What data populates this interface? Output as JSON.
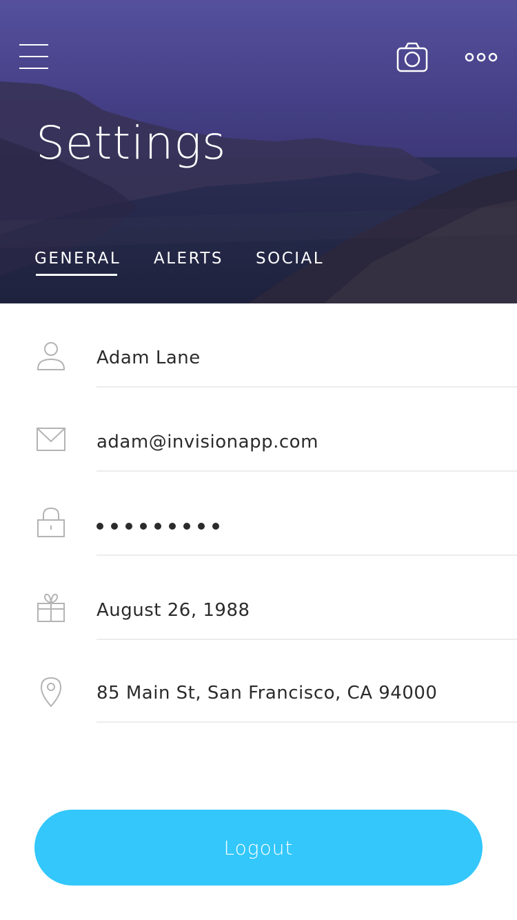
{
  "header": {
    "title": "Settings",
    "tabs": [
      {
        "label": "GENERAL",
        "active": true
      },
      {
        "label": "ALERTS",
        "active": false
      },
      {
        "label": "SOCIAL",
        "active": false
      }
    ],
    "icons": {
      "menu": "hamburger-menu-icon",
      "camera": "camera-icon",
      "more": "more-options-icon"
    }
  },
  "fields": {
    "name": {
      "icon": "user-icon",
      "value": "Adam Lane"
    },
    "email": {
      "icon": "mail-icon",
      "value": "adam@invisionapp.com"
    },
    "password": {
      "icon": "lock-icon",
      "masked_length": 9
    },
    "birthday": {
      "icon": "gift-icon",
      "value": "August 26, 1988"
    },
    "address": {
      "icon": "location-pin-icon",
      "value": "85 Main St, San Francisco, CA 94000"
    }
  },
  "logout": {
    "label": "Logout"
  },
  "colors": {
    "accent": "#33c7fb",
    "header_top": "#5a55a3",
    "icon_gray": "#b3b3b3",
    "text": "#2b2b2b"
  }
}
